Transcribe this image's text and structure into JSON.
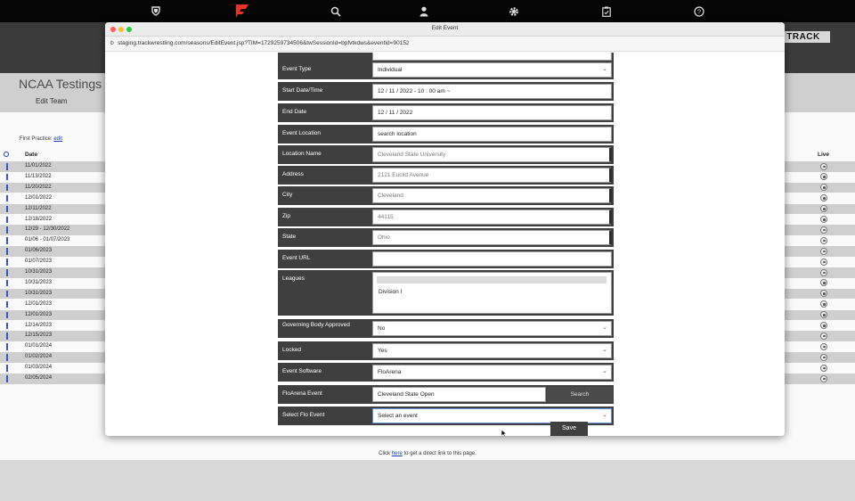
{
  "nav": {
    "icons": [
      "shield-icon",
      "flo-logo",
      "search-icon",
      "user-icon",
      "gear-icon",
      "clipboard-icon",
      "help-icon"
    ]
  },
  "background": {
    "brand": "TRACK",
    "title": "NCAA Testings",
    "edit_team": "Edit Team",
    "first_practice_label": "First Practice:",
    "first_practice_link": "edit",
    "col_date": "Date",
    "col_live": "Live",
    "rows": [
      {
        "date": "11/01/2022"
      },
      {
        "date": "11/13/2022"
      },
      {
        "date": "11/20/2022"
      },
      {
        "date": "12/01/2022"
      },
      {
        "date": "12/11/2022"
      },
      {
        "date": "12/18/2022"
      },
      {
        "date": "12/29 - 12/30/2022"
      },
      {
        "date": "01/06 - 01/07/2023"
      },
      {
        "date": "01/06/2023"
      },
      {
        "date": "01/07/2023"
      },
      {
        "date": "10/31/2023"
      },
      {
        "date": "10/31/2023"
      },
      {
        "date": "10/31/2023"
      },
      {
        "date": "12/01/2023"
      },
      {
        "date": "12/01/2023"
      },
      {
        "date": "12/14/2023"
      },
      {
        "date": "12/15/2023"
      },
      {
        "date": "01/01/2024"
      },
      {
        "date": "01/02/2024"
      },
      {
        "date": "01/03/2024"
      },
      {
        "date": "02/05/2024"
      }
    ],
    "footer_prefix": "Click",
    "footer_link": "here",
    "footer_suffix": "to get a direct link to this page."
  },
  "popup": {
    "title": "Edit Event",
    "url": "staging.trackwrestling.com/seasons/EditEvent.jsp?TIM=1729259734506&twSessionId=bpfvtkdws&eventId=90152",
    "fields": {
      "event_type": {
        "label": "Event Type",
        "value": "Individual"
      },
      "start": {
        "label": "Start Date/Time",
        "value": "12 / 11 / 2022 - 10 : 00  am  ~"
      },
      "end": {
        "label": "End Date",
        "value": "12 / 11 / 2022"
      },
      "location": {
        "label": "Event Location",
        "value": "search location"
      },
      "location_name": {
        "label": "Location Name",
        "value": "Cleveland State University"
      },
      "address": {
        "label": "Address",
        "value": "2121 Euclid Avenue"
      },
      "city": {
        "label": "City",
        "value": "Cleveland"
      },
      "zip": {
        "label": "Zip",
        "value": "44115"
      },
      "state": {
        "label": "State",
        "value": "Ohio"
      },
      "event_url": {
        "label": "Event URL",
        "value": ""
      },
      "leagues": {
        "label": "Leagues",
        "value": "Division I"
      },
      "governing": {
        "label": "Governing Body Approved",
        "value": "No"
      },
      "locked": {
        "label": "Locked",
        "value": "Yes"
      },
      "software": {
        "label": "Event Software",
        "value": "FloArena"
      },
      "floarena_event": {
        "label": "FloArena Event",
        "value": "Cleveland State Open",
        "button": "Search"
      },
      "flo_event": {
        "label": "Select Flo Event",
        "value": "Select an event"
      }
    },
    "save_label": "Save"
  }
}
